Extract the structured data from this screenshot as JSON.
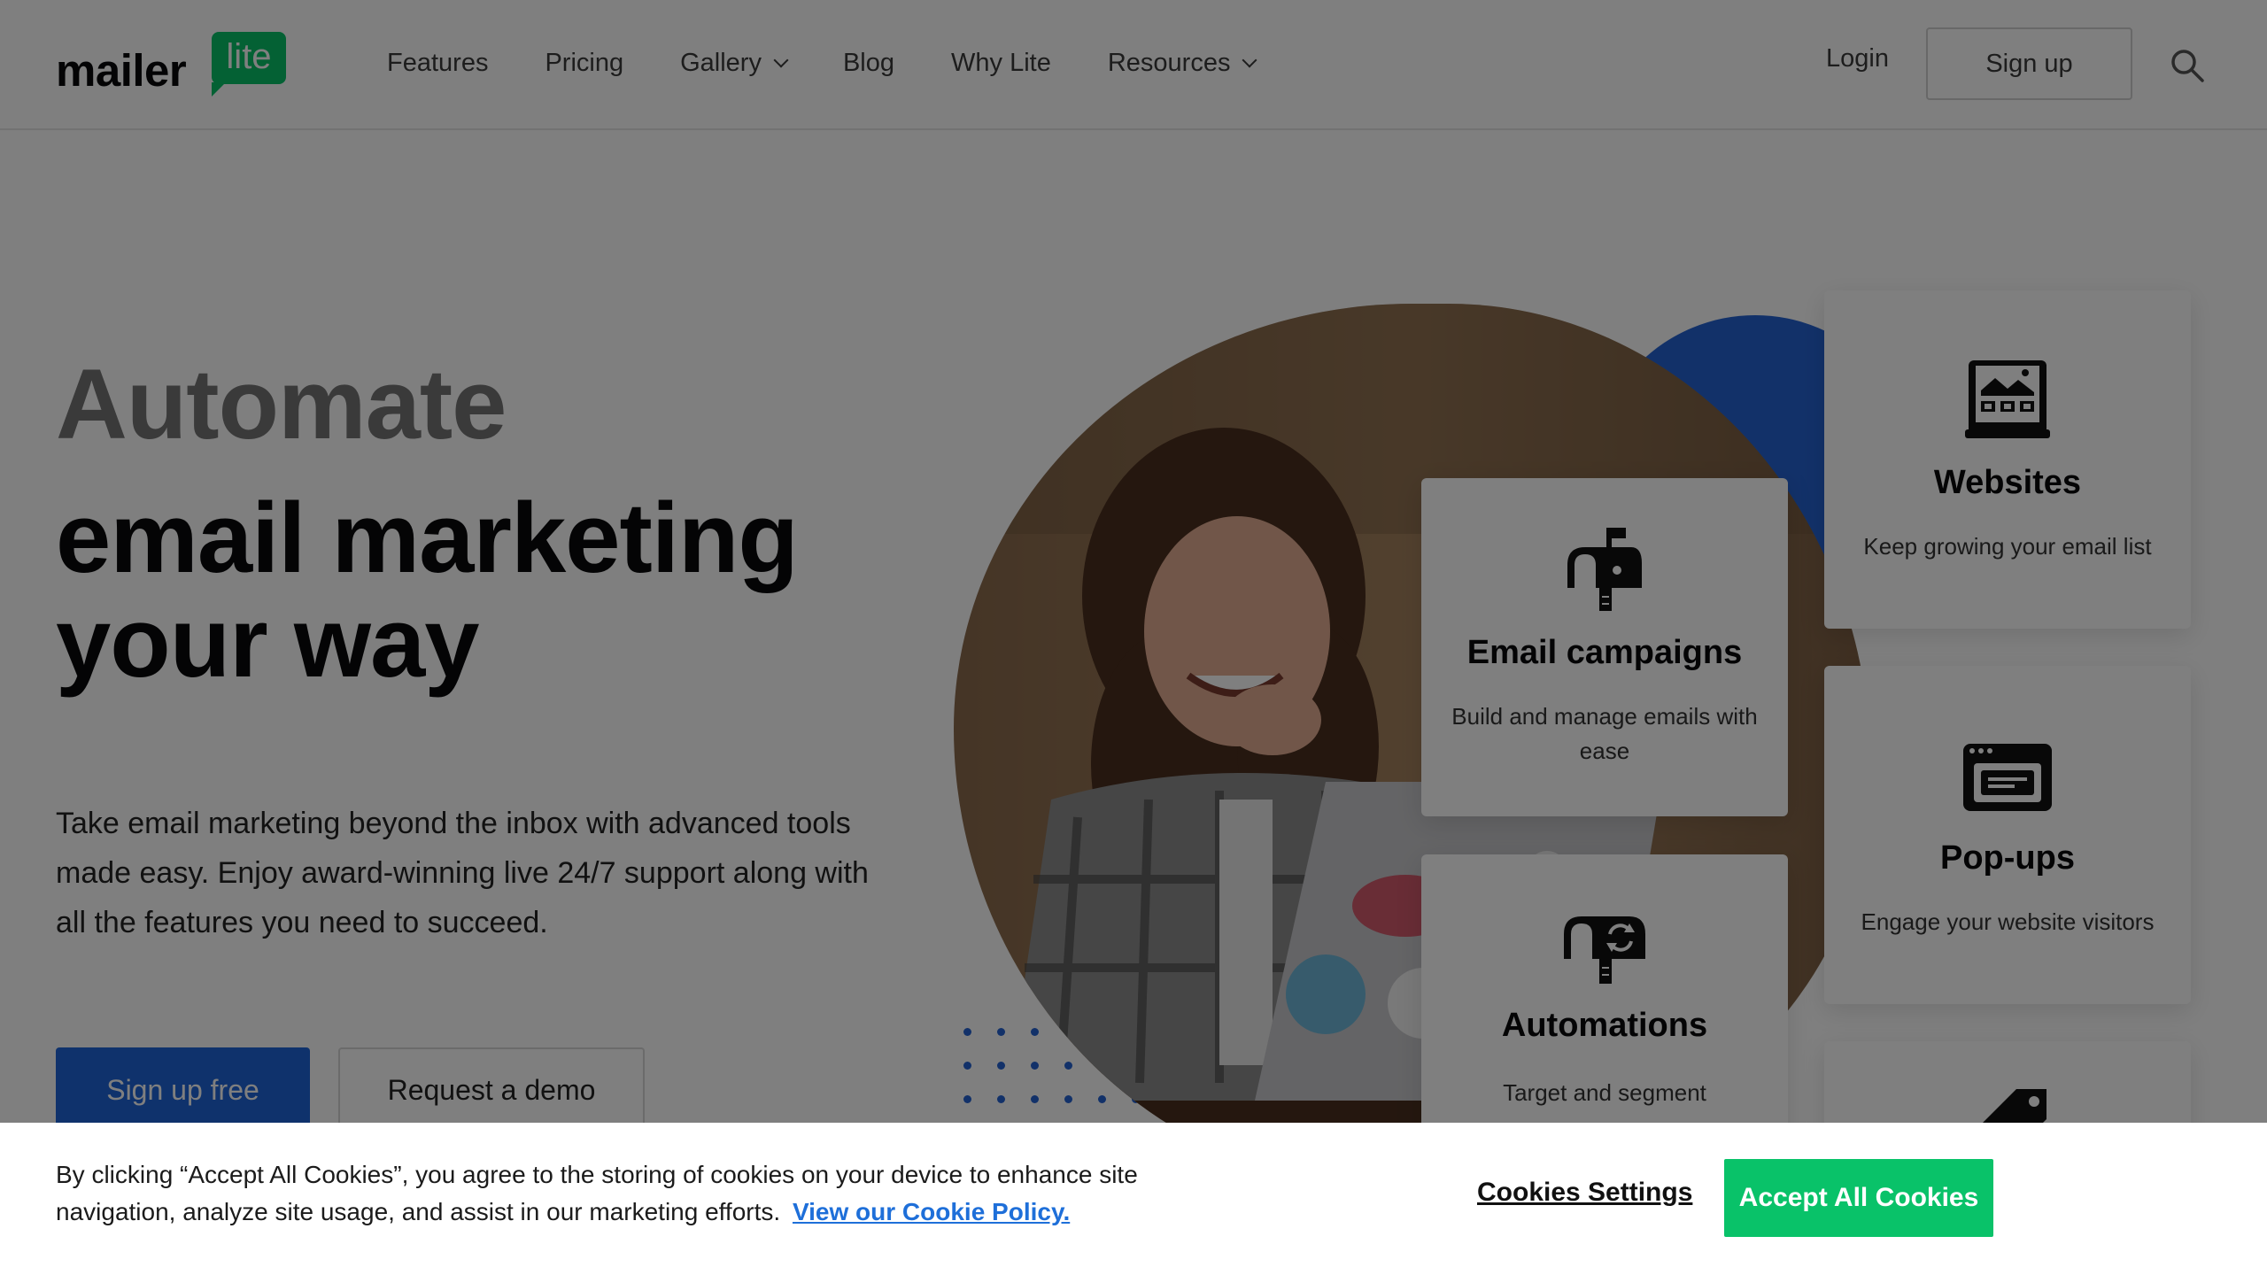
{
  "brand": {
    "logo_word": "mailer",
    "logo_badge": "lite",
    "accent_green": "#09c269",
    "accent_blue": "#1e64d8"
  },
  "header": {
    "nav": [
      {
        "label": "Features",
        "has_dropdown": false
      },
      {
        "label": "Pricing",
        "has_dropdown": false
      },
      {
        "label": "Gallery",
        "has_dropdown": true
      },
      {
        "label": "Blog",
        "has_dropdown": false
      },
      {
        "label": "Why Lite",
        "has_dropdown": false
      },
      {
        "label": "Resources",
        "has_dropdown": true
      }
    ],
    "login_label": "Login",
    "signup_label": "Sign up",
    "search_icon": "search-icon"
  },
  "hero": {
    "headline_muted": "Automate",
    "headline_line1": "email marketing",
    "headline_line2": "your way",
    "description": "Take email marketing beyond the inbox with advanced tools made easy. Enjoy award-winning live 24/7 support along with all the features you need to succeed.",
    "cta_primary": "Sign up free",
    "cta_secondary": "Request a demo"
  },
  "features": {
    "email_campaigns": {
      "title": "Email campaigns",
      "desc": "Build and manage emails with ease",
      "icon": "mailbox-icon"
    },
    "automations": {
      "title": "Automations",
      "desc": "Target and segment",
      "icon": "automation-mailbox-icon"
    },
    "websites": {
      "title": "Websites",
      "desc": "Keep growing your email list",
      "icon": "website-icon"
    },
    "popups": {
      "title": "Pop-ups",
      "desc": "Engage your website visitors",
      "icon": "popup-window-icon"
    },
    "partial_card_icon": "price-tag-icon"
  },
  "cookie_banner": {
    "text": "By clicking “Accept All Cookies”, you agree to the storing of cookies on your device to enhance site navigation, analyze site usage, and assist in our marketing efforts.",
    "policy_link": "View our Cookie Policy.",
    "settings_label": "Cookies Settings",
    "accept_label": "Accept All Cookies"
  }
}
